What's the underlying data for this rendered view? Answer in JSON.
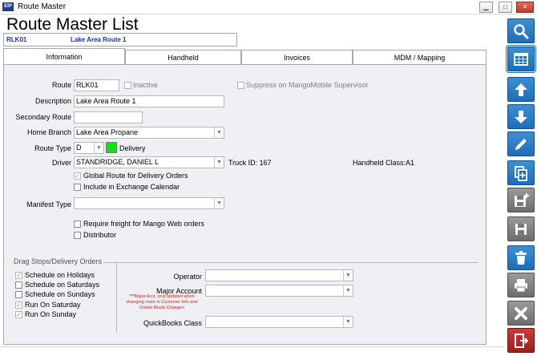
{
  "window": {
    "title": "Route Master",
    "icon_text": "EIP"
  },
  "page": {
    "title": "Route Master List"
  },
  "header": {
    "route_code": "RLK01",
    "route_name": "Lake Area Route 1"
  },
  "tabs": [
    {
      "label": "Information",
      "active": true
    },
    {
      "label": "Handheld",
      "active": false
    },
    {
      "label": "Invoices",
      "active": false
    },
    {
      "label": "MDM / Mapping",
      "active": false
    }
  ],
  "form": {
    "route_label": "Route",
    "route_value": "RLK01",
    "inactive_label": "Inactive",
    "inactive_checked": false,
    "suppress_label": "Suppress on MangoMobile Supervisor",
    "suppress_checked": false,
    "description_label": "Description",
    "description_value": "Lake Area Route 1",
    "secondary_route_label": "Secondary Route",
    "secondary_route_value": "",
    "home_branch_label": "Home Branch",
    "home_branch_value": "Lake Area Propane",
    "route_type_label": "Route Type",
    "route_type_value": "D",
    "route_type_color": "#11e011",
    "route_type_desc": "Delivery",
    "driver_label": "Driver",
    "driver_value": "STANDRIDGE, DANIEL L",
    "truck_id": "Truck ID: 167",
    "handheld_class": "Handheld Class:A1",
    "global_route_label": "Global Route for Delivery Orders",
    "global_route_checked": true,
    "exchange_calendar_label": "Include in Exchange Calendar",
    "exchange_calendar_checked": false,
    "manifest_type_label": "Manifest Type",
    "manifest_type_value": "",
    "require_freight_label": "Require freight for Mango Web orders",
    "require_freight_checked": false,
    "distributor_label": "Distributor",
    "distributor_checked": false
  },
  "drag_stops": {
    "title": "Drag Stops/Delivery Orders",
    "items": [
      {
        "label": "Schedule on Holidays",
        "checked": true
      },
      {
        "label": "Schedule on Saturdays",
        "checked": false
      },
      {
        "label": "Schedule on Sundays",
        "checked": false
      },
      {
        "label": "Run On Saturday",
        "checked": true
      },
      {
        "label": "Run On Sunday",
        "checked": true
      }
    ]
  },
  "right_fields": {
    "operator_label": "Operator",
    "operator_value": "",
    "major_account_label": "Major Account",
    "major_account_value": "",
    "major_account_note": "***Major Acct. only updated when changing route in Customer Info and Global Route Changes",
    "quickbooks_label": "QuickBooks Class",
    "quickbooks_value": ""
  },
  "toolbar": [
    {
      "name": "search-button",
      "icon": "search-icon"
    },
    {
      "name": "grid-view-button",
      "icon": "grid-icon"
    },
    {
      "name": "previous-button",
      "icon": "arrow-up-icon"
    },
    {
      "name": "next-button",
      "icon": "arrow-down-icon"
    },
    {
      "name": "edit-button",
      "icon": "pencil-icon"
    },
    {
      "name": "copy-button",
      "icon": "copy-icon"
    },
    {
      "name": "save-new-button",
      "icon": "save-new-icon"
    },
    {
      "name": "save-button",
      "icon": "save-icon"
    },
    {
      "name": "delete-button",
      "icon": "trash-icon"
    },
    {
      "name": "print-button",
      "icon": "printer-icon"
    },
    {
      "name": "cancel-button",
      "icon": "x-icon"
    },
    {
      "name": "exit-button",
      "icon": "exit-icon"
    }
  ]
}
